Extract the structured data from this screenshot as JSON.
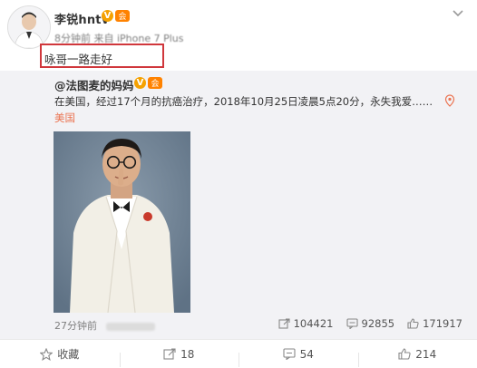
{
  "post": {
    "username": "李锐hntv",
    "meta_time": "8分钟前",
    "meta_source": "来自 iPhone 7 Plus",
    "text": "咏哥一路走好",
    "badges": {
      "verified": "V",
      "member": "会"
    }
  },
  "repost": {
    "username": "@法图麦的妈妈",
    "text": "在美国，经过17个月的抗癌治疗，2018年10月25日凌晨5点20分，永失我爱……",
    "location": "美国",
    "time": "27分钟前",
    "actions": [
      {
        "icon": "share-icon",
        "count": "104421"
      },
      {
        "icon": "comment-icon",
        "count": "92855"
      },
      {
        "icon": "like-icon",
        "count": "171917"
      }
    ]
  },
  "bottom_bar": [
    {
      "icon": "star-icon",
      "label": "收藏"
    },
    {
      "icon": "share-icon",
      "label": "18"
    },
    {
      "icon": "comment-icon",
      "label": "54"
    },
    {
      "icon": "like-icon",
      "label": "214"
    }
  ],
  "colors": {
    "highlight": "#d0373c",
    "repost_bg": "#f2f2f5",
    "location": "#eb7350",
    "verified": "#f5a100"
  }
}
